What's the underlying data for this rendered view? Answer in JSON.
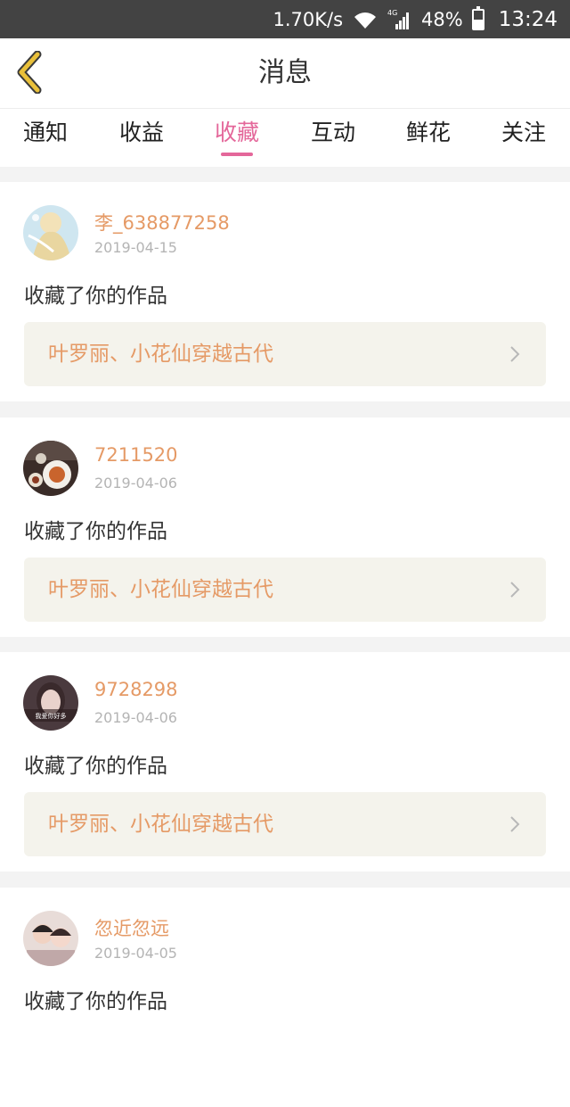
{
  "status_bar": {
    "net_speed": "1.70K/s",
    "network_type": "4G",
    "battery_percent": "48%",
    "battery_level": 0.48,
    "time": "13:24",
    "icons": [
      "wifi-icon",
      "signal-icon",
      "battery-icon"
    ]
  },
  "header": {
    "title": "消息",
    "back_icon": "chevron-left-icon"
  },
  "tabs": [
    {
      "label": "通知"
    },
    {
      "label": "收益"
    },
    {
      "label": "收藏",
      "active": true
    },
    {
      "label": "互动"
    },
    {
      "label": "鲜花"
    },
    {
      "label": "关注"
    }
  ],
  "messages": [
    {
      "username": "李_638877258",
      "date": "2019-04-15",
      "action": "收藏了你的作品",
      "work_title": "叶罗丽、小花仙穿越古代"
    },
    {
      "username": "7211520",
      "date": "2019-04-06",
      "action": "收藏了你的作品",
      "work_title": "叶罗丽、小花仙穿越古代"
    },
    {
      "username": "9728298",
      "date": "2019-04-06",
      "action": "收藏了你的作品",
      "work_title": "叶罗丽、小花仙穿越古代",
      "avatar_text": "我爱你好多"
    },
    {
      "username": "忽近忽远",
      "date": "2019-04-05",
      "action": "收藏了你的作品"
    }
  ],
  "colors": {
    "accent_pink": "#e4679a",
    "username_orange": "#e59a66",
    "back_arrow_yellow": "#e9c03a",
    "status_bar_bg": "#434343",
    "link_bg": "#f4f3ec"
  }
}
